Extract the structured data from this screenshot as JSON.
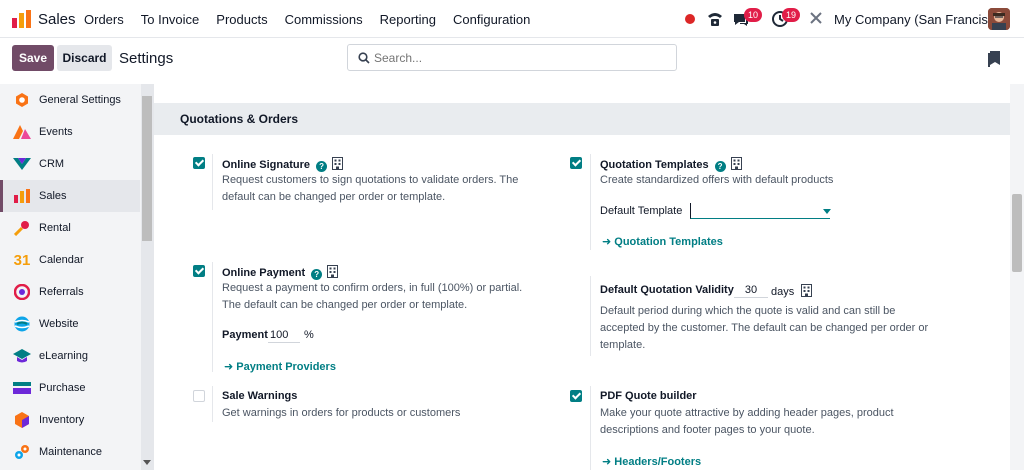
{
  "navbar": {
    "app_name": "Sales",
    "menu": [
      "Orders",
      "To Invoice",
      "Products",
      "Commissions",
      "Reporting",
      "Configuration"
    ],
    "messages_badge": "10",
    "activities_badge": "19",
    "company": "My Company (San Francisco)"
  },
  "control_panel": {
    "save_label": "Save",
    "discard_label": "Discard",
    "title": "Settings",
    "search_placeholder": "Search..."
  },
  "sidebar": {
    "items": [
      {
        "label": "General Settings",
        "icon": "gear-hex-icon",
        "color": "#f97316"
      },
      {
        "label": "Events",
        "icon": "events-icon",
        "color": "#f97316"
      },
      {
        "label": "CRM",
        "icon": "crm-icon",
        "color": "#017e84"
      },
      {
        "label": "Sales",
        "icon": "sales-chart-icon",
        "color": "#f59e0b",
        "active": true
      },
      {
        "label": "Rental",
        "icon": "rental-key-icon",
        "color": "#e11d48"
      },
      {
        "label": "Calendar",
        "icon": "calendar-icon",
        "color": "#f59e0b"
      },
      {
        "label": "Referrals",
        "icon": "referrals-icon",
        "color": "#e11d48"
      },
      {
        "label": "Website",
        "icon": "website-icon",
        "color": "#0ea5e9"
      },
      {
        "label": "eLearning",
        "icon": "elearning-icon",
        "color": "#017e84"
      },
      {
        "label": "Purchase",
        "icon": "purchase-icon",
        "color": "#017e84"
      },
      {
        "label": "Inventory",
        "icon": "inventory-icon",
        "color": "#f97316"
      },
      {
        "label": "Maintenance",
        "icon": "maintenance-icon",
        "color": "#0ea5e9"
      }
    ]
  },
  "section": {
    "title": "Quotations & Orders",
    "online_signature": {
      "title": "Online Signature",
      "checked": true,
      "desc": "Request customers to sign quotations to validate orders. The default can be changed per order or template."
    },
    "quotation_templates": {
      "title": "Quotation Templates",
      "checked": true,
      "desc": "Create standardized offers with default products",
      "field_label": "Default Template",
      "field_value": "",
      "link": "Quotation Templates"
    },
    "online_payment": {
      "title": "Online Payment",
      "checked": true,
      "desc": "Request a payment to confirm orders, in full (100%) or partial. The default can be changed per order or template.",
      "field_label": "Payment",
      "field_value": "100",
      "field_unit": "%",
      "link": "Payment Providers"
    },
    "validity": {
      "title": "Default Quotation Validity",
      "value": "30",
      "unit": "days",
      "desc": "Default period during which the quote is valid and can still be accepted by the customer. The default can be changed per order or template."
    },
    "sale_warnings": {
      "title": "Sale Warnings",
      "checked": false,
      "desc": "Get warnings in orders for products or customers"
    },
    "pdf_builder": {
      "title": "PDF Quote builder",
      "checked": true,
      "desc": "Make your quote attractive by adding header pages, product descriptions and footer pages to your quote.",
      "link": "Headers/Footers"
    }
  },
  "colors": {
    "accent": "#714b67",
    "teal": "#017e84",
    "badge": "#e11d48"
  }
}
